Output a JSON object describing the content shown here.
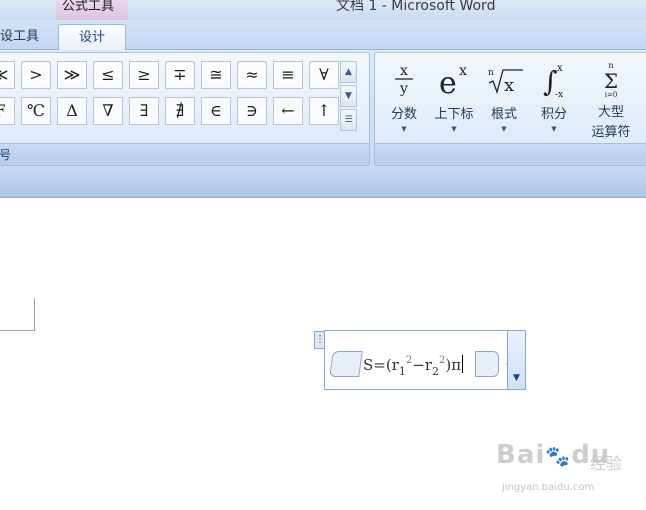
{
  "window": {
    "context_tab_label": "公式工具",
    "title": "文档 1 - Microsoft Word"
  },
  "tabs": {
    "layout": "设工具",
    "design": "设计"
  },
  "ribbon": {
    "symbols_group_label": "号",
    "symbols_row1": [
      "≪",
      ">",
      "≫",
      "≤",
      "≥",
      "∓",
      "≅",
      "≈",
      "≡",
      "∀"
    ],
    "symbols_row2": [
      "F",
      "℃",
      "Δ",
      "∇",
      "∃",
      "∄",
      "∈",
      "∋",
      "←",
      "↑"
    ],
    "structures": [
      {
        "id": "fraction",
        "label": "分数"
      },
      {
        "id": "script",
        "label": "上下标"
      },
      {
        "id": "radical",
        "label": "根式"
      },
      {
        "id": "integral",
        "label": "积分"
      },
      {
        "id": "large_operator",
        "label": "大型\n运算符"
      }
    ]
  },
  "equation": {
    "lead": "S=(r",
    "sub1": "1",
    "sup1": "2",
    "mid": "−r",
    "sub2": "2",
    "sup2": "2",
    "tail": ")π"
  },
  "watermark": {
    "brand": "Bai",
    "brand_suffix": "du",
    "cn": "经验",
    "url": "jingyan.baidu.com"
  }
}
